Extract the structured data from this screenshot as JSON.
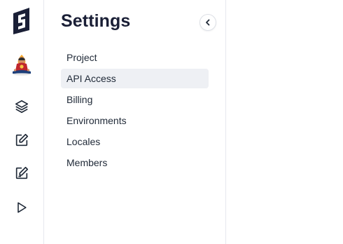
{
  "icons": {
    "logo": "hygraph-logo-icon",
    "avatar": "project-avatar-meditating-figure",
    "layers": "layers-icon",
    "edit_1": "edit-square-icon",
    "edit_2": "edit-square-icon",
    "play": "play-icon",
    "collapse": "chevron-left-icon"
  },
  "colors": {
    "brand": "#1a1f36",
    "active_item_bg": "#eef0f4",
    "border": "#e6e8ee"
  },
  "settings": {
    "title": "Settings",
    "items": [
      {
        "label": "Project",
        "active": false
      },
      {
        "label": "API Access",
        "active": true
      },
      {
        "label": "Billing",
        "active": false
      },
      {
        "label": "Environments",
        "active": false
      },
      {
        "label": "Locales",
        "active": false
      },
      {
        "label": "Members",
        "active": false
      }
    ]
  }
}
